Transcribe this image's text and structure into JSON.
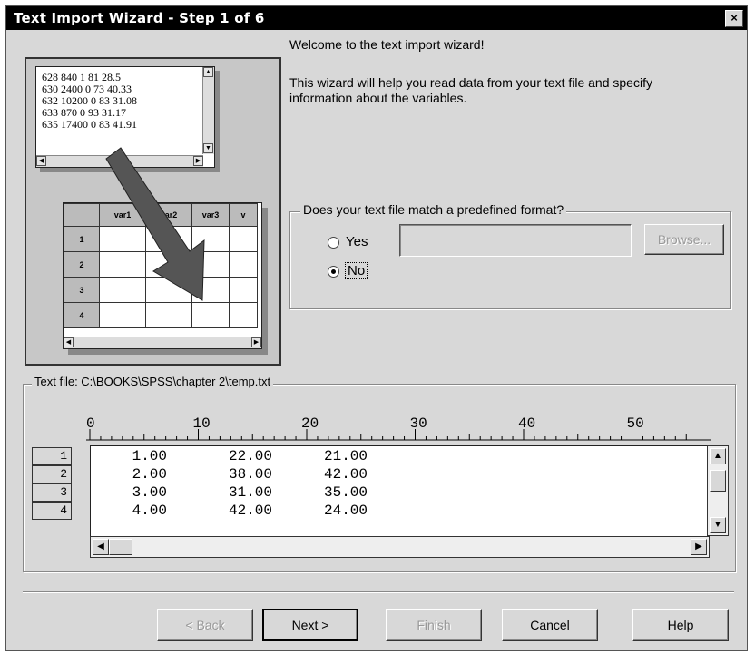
{
  "window": {
    "title": "Text Import Wizard - Step 1 of 6",
    "close_label": "×"
  },
  "illustration": {
    "text_lines": [
      "628 840 1 81 28.5",
      "630 2400 0 73 40.33",
      "632 10200 0 83 31.08",
      "633 870 0 93 31.17",
      "635 17400 0 83 41.91"
    ],
    "grid_headers": [
      "var1",
      "var2",
      "var3",
      "v"
    ],
    "grid_rows": [
      "1",
      "2",
      "3",
      "4"
    ]
  },
  "intro": {
    "welcome": "Welcome to the text import wizard!",
    "description": "This wizard will help you read data from your text file and specify information about the variables."
  },
  "format_group": {
    "label": "Does your text file match a predefined format?",
    "options": [
      {
        "label": "Yes",
        "selected": false
      },
      {
        "label": "No",
        "selected": true
      }
    ],
    "path_value": "",
    "browse_label": "Browse..."
  },
  "preview": {
    "label": "Text file: C:\\BOOKS\\SPSS\\chapter 2\\temp.txt",
    "ruler_marks": [
      "0",
      "10",
      "20",
      "30",
      "40",
      "50"
    ],
    "rows": [
      {
        "num": "1",
        "cells": [
          "1.00",
          "22.00",
          "21.00"
        ]
      },
      {
        "num": "2",
        "cells": [
          "2.00",
          "38.00",
          "42.00"
        ]
      },
      {
        "num": "3",
        "cells": [
          "3.00",
          "31.00",
          "35.00"
        ]
      },
      {
        "num": "4",
        "cells": [
          "4.00",
          "42.00",
          "24.00"
        ]
      }
    ]
  },
  "buttons": {
    "back": "< Back",
    "next": "Next >",
    "finish": "Finish",
    "cancel": "Cancel",
    "help": "Help"
  }
}
